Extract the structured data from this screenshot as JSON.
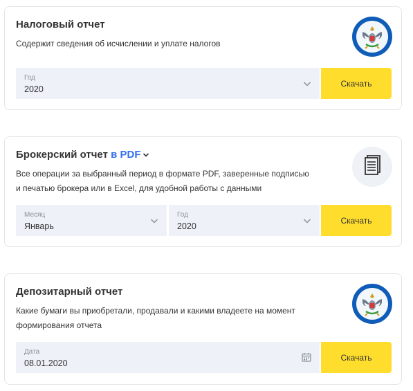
{
  "colors": {
    "accent_yellow": "#ffdd2d",
    "link_blue": "#336fee",
    "field_bg": "#eef2f8",
    "emblem_blue": "#0f5db8"
  },
  "tax_report": {
    "title": "Налоговый отчет",
    "description": "Содержит сведения об исчислении и уплате налогов",
    "logo_icon": "russian-tax-service-emblem-icon",
    "year_field": {
      "label": "Год",
      "value": "2020"
    },
    "download_label": "Скачать"
  },
  "broker_report": {
    "title": "Брокерский отчет",
    "format_link": "в PDF",
    "description_line1": "Все операции за выбранный период в формате PDF, заверенные подписью",
    "description_line2": "и печатью брокера или в Excel, для удобной работы с данными",
    "logo_icon": "document-icon",
    "month_field": {
      "label": "Месяц",
      "value": "Январь"
    },
    "year_field": {
      "label": "Год",
      "value": "2020"
    },
    "download_label": "Скачать"
  },
  "depository_report": {
    "title": "Депозитарный отчет",
    "description_line1": "Какие бумаги вы приобретали, продавали и какими владеете на момент",
    "description_line2": "формирования отчета",
    "logo_icon": "russian-emblem-icon",
    "date_field": {
      "label": "Дата",
      "value": "08.01.2020"
    },
    "download_label": "Скачать"
  }
}
